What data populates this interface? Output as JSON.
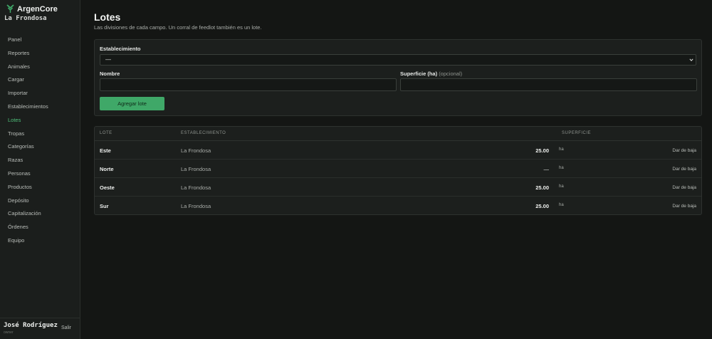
{
  "sidebar": {
    "brand": "ArgenCore",
    "farm": "La Frondosa",
    "items": [
      {
        "label": "Panel"
      },
      {
        "label": "Reportes"
      },
      {
        "label": "Animales"
      },
      {
        "label": "Cargar"
      },
      {
        "label": "Importar"
      },
      {
        "label": "Establecimientos"
      },
      {
        "label": "Lotes"
      },
      {
        "label": "Tropas"
      },
      {
        "label": "Categorías"
      },
      {
        "label": "Razas"
      },
      {
        "label": "Personas"
      },
      {
        "label": "Productos"
      },
      {
        "label": "Depósito"
      },
      {
        "label": "Capitalización"
      },
      {
        "label": "Órdenes"
      },
      {
        "label": "Equipo"
      }
    ],
    "active_item": "Lotes",
    "user_name": "José Rodríguez",
    "user_sub": "owner",
    "logout_label": "Salir"
  },
  "page": {
    "title": "Lotes",
    "subtitle": "Las divisiones de cada campo. Un corral de feedlot también es un lote."
  },
  "form": {
    "establecimiento_label": "Establecimiento",
    "establecimiento_value": "—",
    "nombre_label": "Nombre",
    "nombre_value": "",
    "superficie_label": "Superficie (ha)",
    "superficie_optional": "(opcional)",
    "superficie_value": "",
    "submit_label": "Agregar lote"
  },
  "table": {
    "headers": {
      "lote": "LOTE",
      "establecimiento": "ESTABLECIMIENTO",
      "superficie": "SUPERFICIE"
    },
    "rows": [
      {
        "lote": "Este",
        "establecimiento": "La Frondosa",
        "superficie": "25.00",
        "unit": "ha",
        "action": "Dar de baja"
      },
      {
        "lote": "Norte",
        "establecimiento": "La Frondosa",
        "superficie": "—",
        "unit": "ha",
        "action": "Dar de baja"
      },
      {
        "lote": "Oeste",
        "establecimiento": "La Frondosa",
        "superficie": "25.00",
        "unit": "ha",
        "action": "Dar de baja"
      },
      {
        "lote": "Sur",
        "establecimiento": "La Frondosa",
        "superficie": "25.00",
        "unit": "ha",
        "action": "Dar de baja"
      }
    ]
  },
  "colors": {
    "accent": "#4fc07a",
    "button": "#3fa868",
    "background": "#141614",
    "sidebar": "#1b1e1c",
    "card": "#1c1f1d"
  },
  "icons": {
    "brand": "brand-logo-icon",
    "select": "chevron-down-icon"
  }
}
